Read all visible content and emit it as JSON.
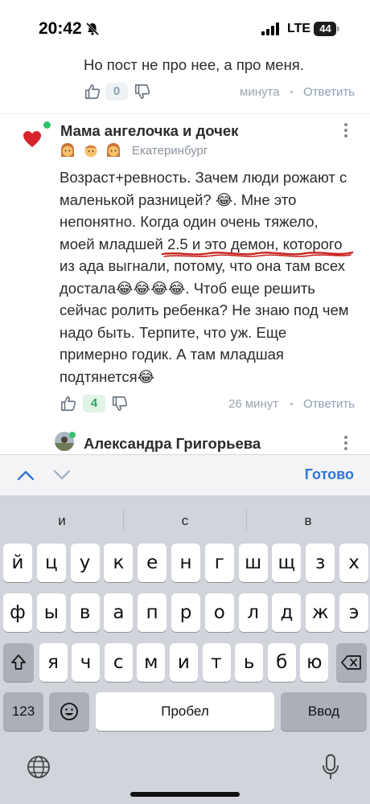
{
  "status_bar": {
    "time": "20:42",
    "network": "LTE",
    "battery_level": "44",
    "icons": [
      "bell-muted-icon",
      "signal-icon",
      "battery-icon"
    ]
  },
  "comment_prev": {
    "text": "Но пост не про нее, а про меня.",
    "vote_count": "0",
    "time": "минута",
    "reply_label": "Ответить"
  },
  "comment_main": {
    "author": "Мама ангелочка и дочек",
    "city": "Екатеринбург",
    "lines": [
      "Возраст+ревность. Зачем люди рожают с",
      "маленькой разницей? 😂. Мне это",
      "непонятно. Когда один очень тяжело,",
      "моей младшей 2.5 и это демон, которого",
      "из ада выгнали, потому, что она там всех",
      "достала😂😂😂😂. Чтоб еще решить",
      "сейчас ролить ребенка? Не знаю под чем",
      "надо быть. Терпите, что уж. Еще",
      "примерно годик. А там младшая",
      "подтянется😂"
    ],
    "vote_count": "4",
    "time": "26 минут",
    "reply_label": "Ответить"
  },
  "comment_next": {
    "author": "Александра Григорьева"
  },
  "keyboard": {
    "done_label": "Готово",
    "suggestions": [
      "и",
      "с",
      "в"
    ],
    "rows": [
      [
        "й",
        "ц",
        "у",
        "к",
        "е",
        "н",
        "г",
        "ш",
        "щ",
        "з",
        "х"
      ],
      [
        "ф",
        "ы",
        "в",
        "а",
        "п",
        "р",
        "о",
        "л",
        "д",
        "ж",
        "э"
      ],
      [
        "я",
        "ч",
        "с",
        "м",
        "и",
        "т",
        "ь",
        "б",
        "ю"
      ]
    ],
    "numbers_label": "123",
    "space_label": "Пробел",
    "return_label": "Ввод"
  },
  "colors": {
    "accent": "#2c77d8",
    "vote_positive": "#2aa55a",
    "vote_zero": "#8aa0b6",
    "online": "#35c06f",
    "heart": "#d8232a"
  }
}
